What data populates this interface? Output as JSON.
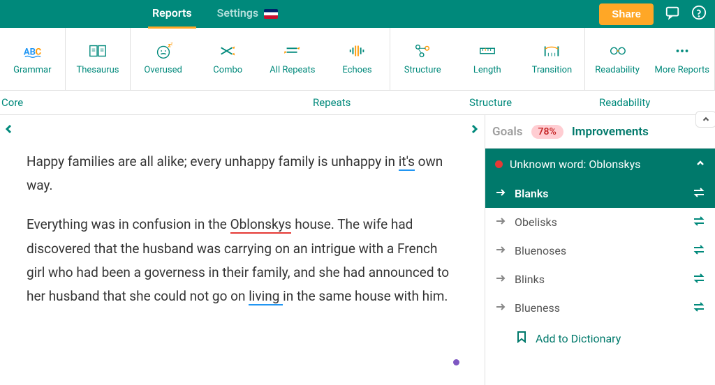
{
  "header": {
    "tabs": {
      "reports": "Reports",
      "settings": "Settings"
    },
    "share": "Share"
  },
  "toolbar": {
    "items": [
      {
        "label": "Grammar"
      },
      {
        "label": "Thesaurus"
      },
      {
        "label": "Overused"
      },
      {
        "label": "Combo"
      },
      {
        "label": "All Repeats"
      },
      {
        "label": "Echoes"
      },
      {
        "label": "Structure"
      },
      {
        "label": "Length"
      },
      {
        "label": "Transition"
      },
      {
        "label": "Readability"
      },
      {
        "label": "More Reports"
      }
    ]
  },
  "categories": {
    "core": "Core",
    "repeats": "Repeats",
    "structure": "Structure",
    "readability": "Readability"
  },
  "editor": {
    "p1_a": "Happy families are all alike; every unhappy family is unhappy in ",
    "p1_its": "it's",
    "p1_b": " own way.",
    "p2_a": "Everything was in confusion in the ",
    "p2_obl": "Oblonskys",
    "p2_b": " house. The wife had discovered that the husband was carrying on an intrigue with a French girl who had been a governess in their family, and she had announced to her husband that she could not go on ",
    "p2_liv": "living ",
    "p2_c": "in the same house with him."
  },
  "sidebar": {
    "goals": "Goals",
    "goals_pct": "78%",
    "improvements": "Improvements",
    "issue_title": "Unknown word: Oblonskys",
    "suggestions": [
      "Blanks",
      "Obelisks",
      "Bluenoses",
      "Blinks",
      "Blueness"
    ],
    "add_dict": "Add to Dictionary"
  }
}
